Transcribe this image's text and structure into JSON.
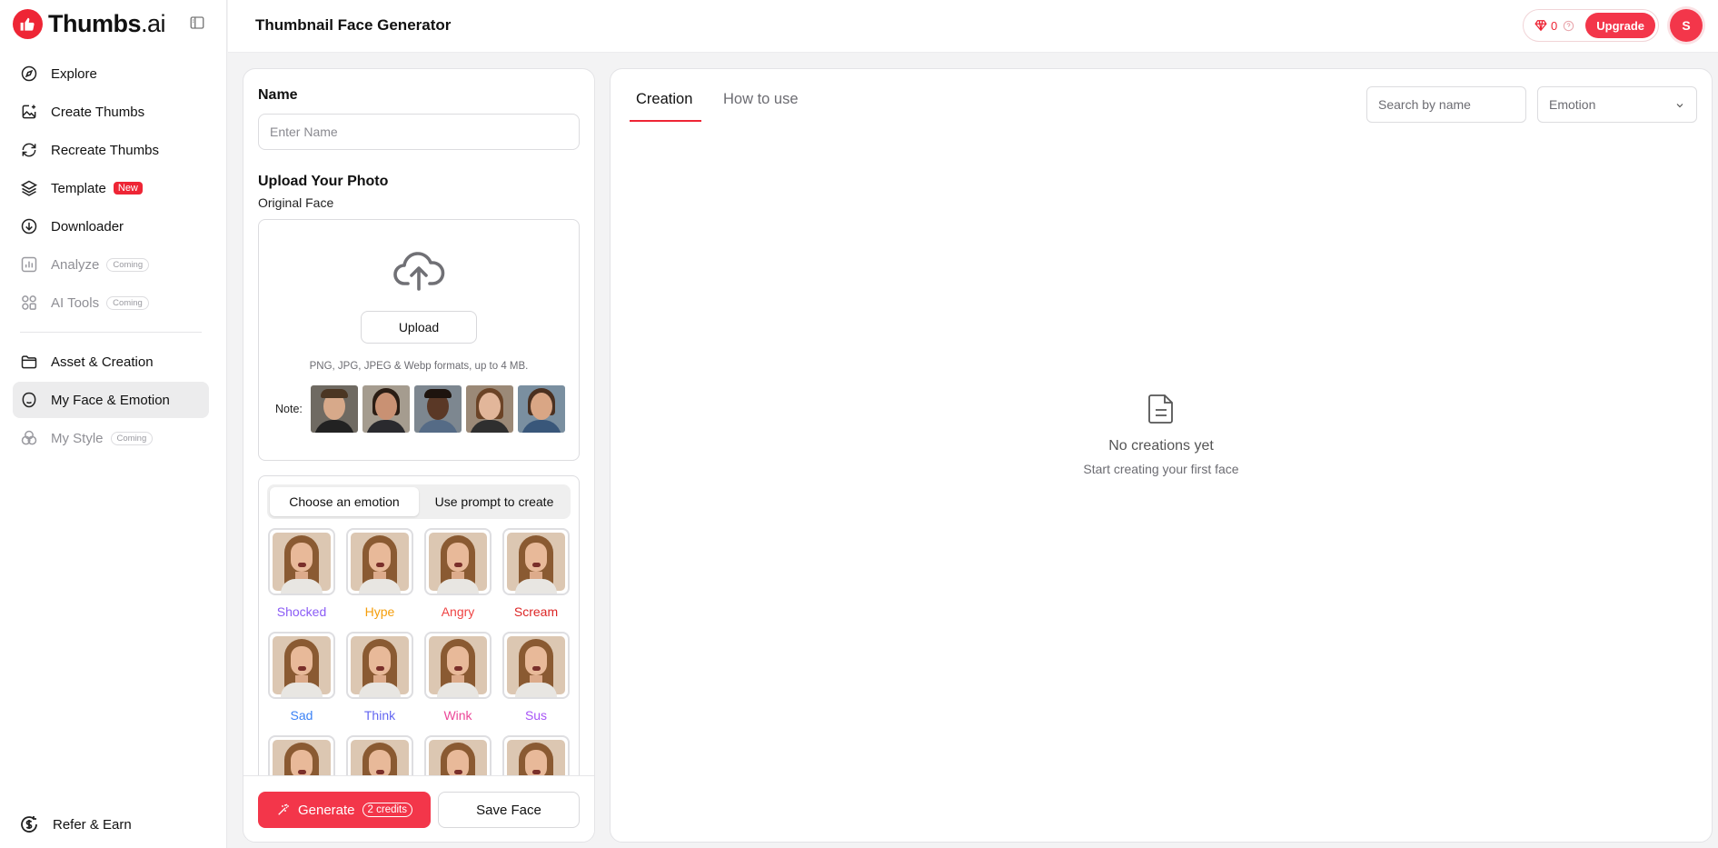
{
  "brand": {
    "name_bold": "Thumbs",
    "name_thin": ".ai",
    "accent": "#ee2535"
  },
  "sidebar": {
    "items": [
      {
        "label": "Explore",
        "icon": "compass-icon",
        "state": "normal"
      },
      {
        "label": "Create Thumbs",
        "icon": "image-sparkle-icon",
        "state": "normal"
      },
      {
        "label": "Recreate Thumbs",
        "icon": "refresh-icon",
        "state": "normal"
      },
      {
        "label": "Template",
        "icon": "layers-icon",
        "state": "normal",
        "badge": "New"
      },
      {
        "label": "Downloader",
        "icon": "download-icon",
        "state": "normal"
      },
      {
        "label": "Analyze",
        "icon": "chart-icon",
        "state": "disabled",
        "badge": "Coming"
      },
      {
        "label": "AI Tools",
        "icon": "grid-icon",
        "state": "disabled",
        "badge": "Coming"
      },
      {
        "label": "Asset & Creation",
        "icon": "folder-icon",
        "state": "normal"
      },
      {
        "label": "My Face & Emotion",
        "icon": "smile-icon",
        "state": "active"
      },
      {
        "label": "My Style",
        "icon": "palette-icon",
        "state": "disabled",
        "badge": "Coming"
      }
    ],
    "refer_label": "Refer & Earn"
  },
  "header": {
    "title": "Thumbnail Face Generator",
    "credits": "0",
    "upgrade_label": "Upgrade",
    "avatar_initial": "S"
  },
  "form": {
    "name_title": "Name",
    "name_placeholder": "Enter Name",
    "upload_title": "Upload Your Photo",
    "original_face_label": "Original Face",
    "upload_button": "Upload",
    "formats_text": "PNG, JPG, JPEG & Webp formats, up to 4 MB.",
    "note_label": "Note:",
    "segment_tabs": [
      "Choose an emotion",
      "Use prompt to create"
    ],
    "emotions": [
      {
        "label": "Shocked",
        "color": "#8b5cf6"
      },
      {
        "label": "Hype",
        "color": "#f59e0b"
      },
      {
        "label": "Angry",
        "color": "#ef4444"
      },
      {
        "label": "Scream",
        "color": "#dc2626"
      },
      {
        "label": "Sad",
        "color": "#3b82f6"
      },
      {
        "label": "Think",
        "color": "#6366f1"
      },
      {
        "label": "Wink",
        "color": "#ec4899"
      },
      {
        "label": "Sus",
        "color": "#a855f7"
      }
    ],
    "generate_label": "Generate",
    "generate_credits": "2 credits",
    "save_label": "Save Face"
  },
  "creations": {
    "tabs": [
      "Creation",
      "How to use"
    ],
    "search_placeholder": "Search by name",
    "emotion_filter": "Emotion",
    "empty_title": "No creations yet",
    "empty_subtitle": "Start creating your first face"
  }
}
